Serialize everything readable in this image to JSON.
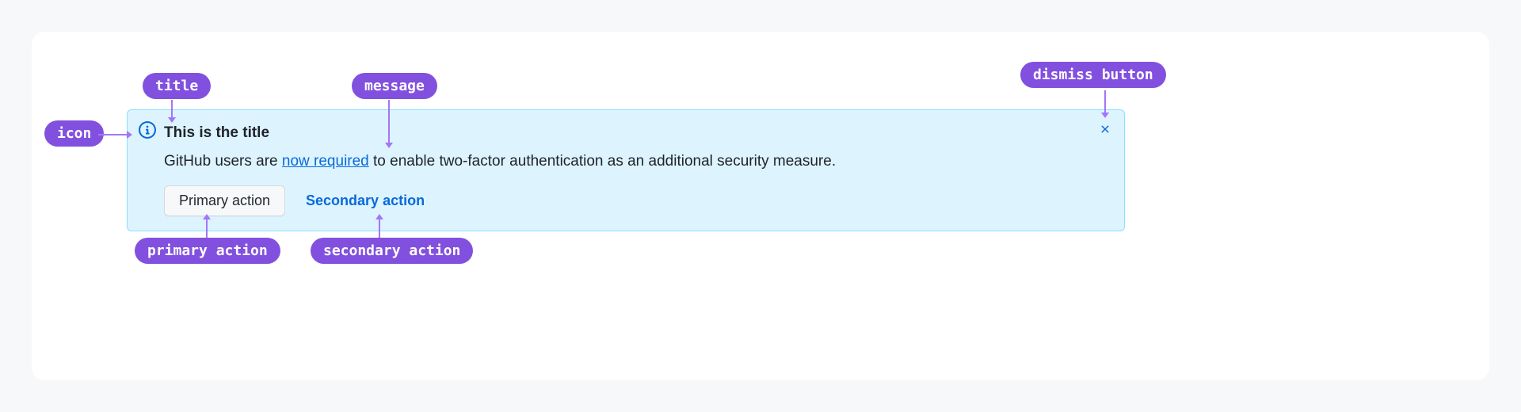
{
  "banner": {
    "title": "This is the title",
    "message_before": "GitHub users are ",
    "message_link": "now required",
    "message_after": " to enable two-factor authentication as an additional security measure.",
    "primary_action": "Primary action",
    "secondary_action": "Secondary action",
    "icon_name": "info-icon",
    "dismiss_name": "close-icon"
  },
  "callouts": {
    "icon": "icon",
    "title": "title",
    "message": "message",
    "dismiss": "dismiss button",
    "primary": "primary action",
    "secondary": "secondary action"
  }
}
